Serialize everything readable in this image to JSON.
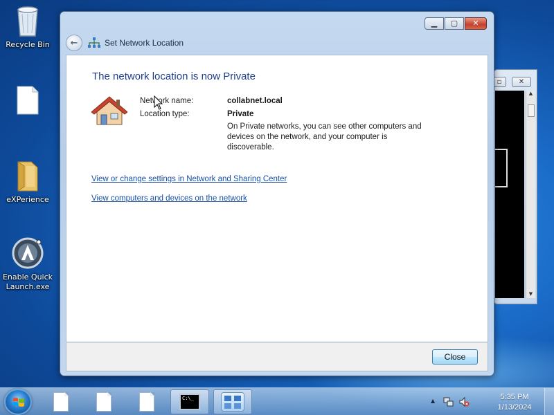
{
  "desktop": {
    "icons": [
      {
        "label": "Recycle Bin",
        "icon": "recycle-bin-icon"
      },
      {
        "label": "",
        "icon": "document-icon"
      },
      {
        "label": "eXPerience",
        "icon": "folder-icon"
      },
      {
        "label": "Enable Quick Launch.exe",
        "icon": "app-icon"
      }
    ]
  },
  "dialog": {
    "title": "Set Network Location",
    "heading": "The network location is now Private",
    "network_name_label": "Network name:",
    "network_name_value": "collabnet.local",
    "location_type_label": "Location type:",
    "location_type_value": "Private",
    "description": "On Private networks, you can see other computers and devices on the network, and your computer is discoverable.",
    "links": [
      "View or change settings in Network and Sharing Center",
      "View computers and devices on the network"
    ],
    "close_label": "Close"
  },
  "taskbar": {
    "cmd_icon_text": "C:\\_",
    "time": "5:35 PM",
    "date": "1/13/2024"
  },
  "colors": {
    "heading": "#1e3e8c",
    "link": "#1a4fa3"
  }
}
